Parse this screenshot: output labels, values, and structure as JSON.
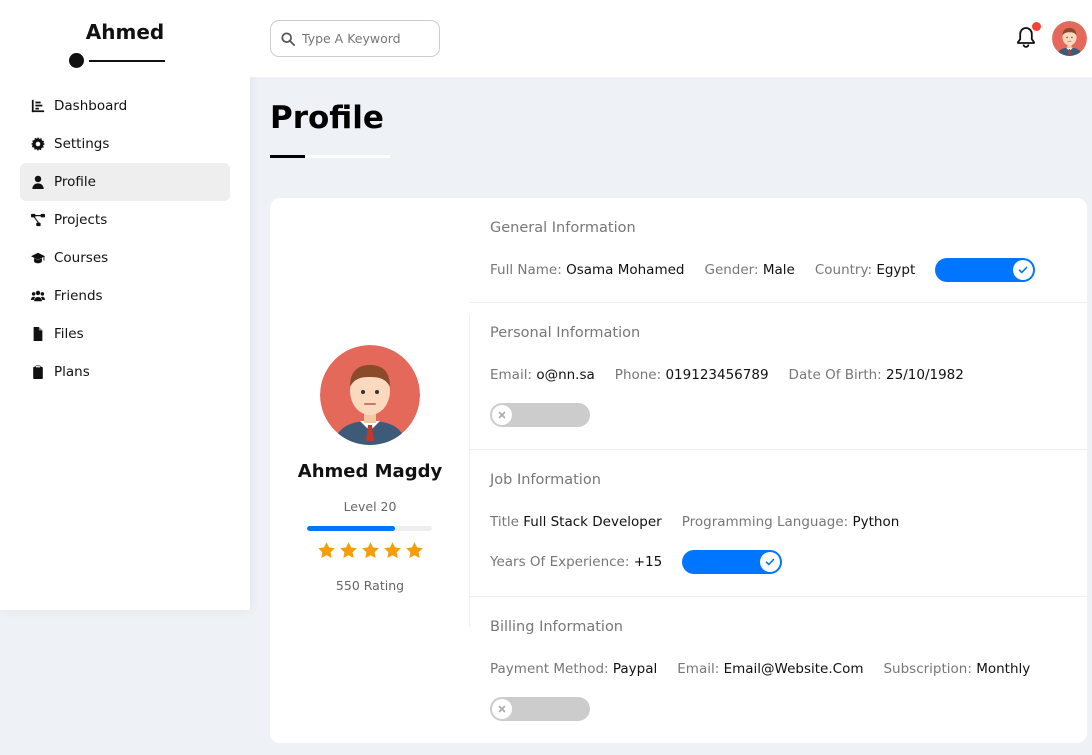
{
  "brand": {
    "name": "Ahmed"
  },
  "sidebar": {
    "items": [
      {
        "label": "Dashboard",
        "icon": "chart-bar-icon",
        "active": false
      },
      {
        "label": "Settings",
        "icon": "gear-icon",
        "active": false
      },
      {
        "label": "Profile",
        "icon": "user-icon",
        "active": true
      },
      {
        "label": "Projects",
        "icon": "diagram-project-icon",
        "active": false
      },
      {
        "label": "Courses",
        "icon": "graduation-cap-icon",
        "active": false
      },
      {
        "label": "Friends",
        "icon": "users-icon",
        "active": false
      },
      {
        "label": "Files",
        "icon": "file-icon",
        "active": false
      },
      {
        "label": "Plans",
        "icon": "clipboard-icon",
        "active": false
      }
    ]
  },
  "header": {
    "search_placeholder": "Type A Keyword",
    "has_notification": true
  },
  "page": {
    "title": "Profile"
  },
  "profile": {
    "name": "Ahmed Magdy",
    "level": "Level 20",
    "level_progress_fraction": 0.7,
    "stars": 5,
    "rating": "550 Rating"
  },
  "sections": {
    "general": {
      "title": "General Information",
      "full_name_label": "Full Name:",
      "full_name": "Osama Mohamed",
      "gender_label": "Gender:",
      "gender": "Male",
      "country_label": "Country:",
      "country": "Egypt",
      "toggle_on": true
    },
    "personal": {
      "title": "Personal Information",
      "email_label": "Email:",
      "email": "o@nn.sa",
      "phone_label": "Phone:",
      "phone": "019123456789",
      "dob_label": "Date Of Birth:",
      "dob": "25/10/1982",
      "toggle_on": false
    },
    "job": {
      "title": "Job Information",
      "title_label": "Title",
      "job_title": "Full Stack Developer",
      "lang_label": "Programming Language:",
      "lang": "Python",
      "years_label": "Years Of Experience:",
      "years": "+15",
      "toggle_on": true
    },
    "billing": {
      "title": "Billing Information",
      "payment_label": "Payment Method:",
      "payment": "Paypal",
      "email_label": "Email:",
      "email": "Email@Website.Com",
      "subscription_label": "Subscription:",
      "subscription": "Monthly",
      "toggle_on": false
    }
  },
  "colors": {
    "accent": "#0075ff",
    "star": "#f59e0b",
    "notification": "#f44336",
    "avatar_bg": "#e5695a"
  }
}
